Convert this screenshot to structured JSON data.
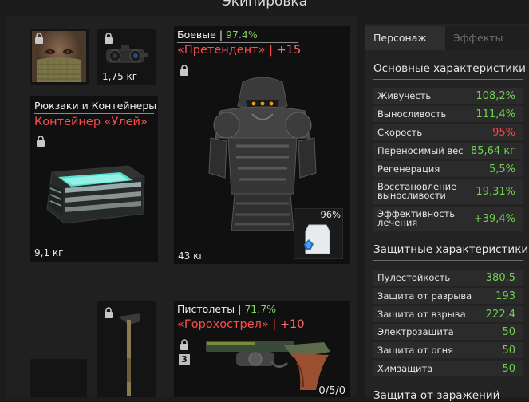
{
  "window": {
    "title": "Экипировка"
  },
  "tabs": {
    "character": "Персонаж",
    "effects": "Эффекты"
  },
  "equipment": {
    "mask": {
      "icon": "mask-icon"
    },
    "device": {
      "icon": "goggles-icon",
      "weight": "1,75 кг"
    },
    "backpack": {
      "category": "Рюкзаки и Контейнеры",
      "name": "Контейнер «Улей»",
      "weight": "9,1 кг",
      "icon": "container-icon"
    },
    "armor": {
      "category": "Боевые",
      "category_pct": "97.4%",
      "name": "«Претендент»",
      "upgrade": "+15",
      "weight": "43 кг",
      "icon": "armor-icon",
      "artifact_durability": "96%"
    },
    "melee": {
      "icon": "axe-icon"
    },
    "pistol": {
      "category": "Пистолеты",
      "category_pct": "71.7%",
      "name": "«Горохострел»",
      "upgrade": "+10",
      "tier": "3",
      "ammo": "0/5/0",
      "icon": "revolver-icon"
    }
  },
  "main_stats": {
    "title": "Основные характеристики",
    "rows": [
      {
        "name": "Живучесть",
        "value": "108,2%",
        "color": "green"
      },
      {
        "name": "Выносливость",
        "value": "111,4%",
        "color": "green"
      },
      {
        "name": "Скорость",
        "value": "95%",
        "color": "red"
      },
      {
        "name": "Переносимый вес",
        "value": "85,64 кг",
        "color": "green"
      },
      {
        "name": "Регенерация",
        "value": "5,5%",
        "color": "green"
      },
      {
        "name": "Восстановление выносливости",
        "name_l1": "Восстановление",
        "name_l2": "выносливости",
        "value": "19,31%",
        "color": "green"
      },
      {
        "name": "Эффективность лечения",
        "name_l1": "Эффективность",
        "name_l2": "лечения",
        "value": "+39,4%",
        "color": "green"
      }
    ]
  },
  "defense_stats": {
    "title": "Защитные характеристики",
    "rows": [
      {
        "name": "Пулестойкость",
        "value": "380,5"
      },
      {
        "name": "Защита от разрыва",
        "value": "193"
      },
      {
        "name": "Защита от взрыва",
        "value": "222,4"
      },
      {
        "name": "Электрозащита",
        "value": "50"
      },
      {
        "name": "Защита от огня",
        "value": "50"
      },
      {
        "name": "Химзащита",
        "value": "50"
      }
    ]
  },
  "contamination_stats": {
    "title": "Защита от заражений"
  }
}
